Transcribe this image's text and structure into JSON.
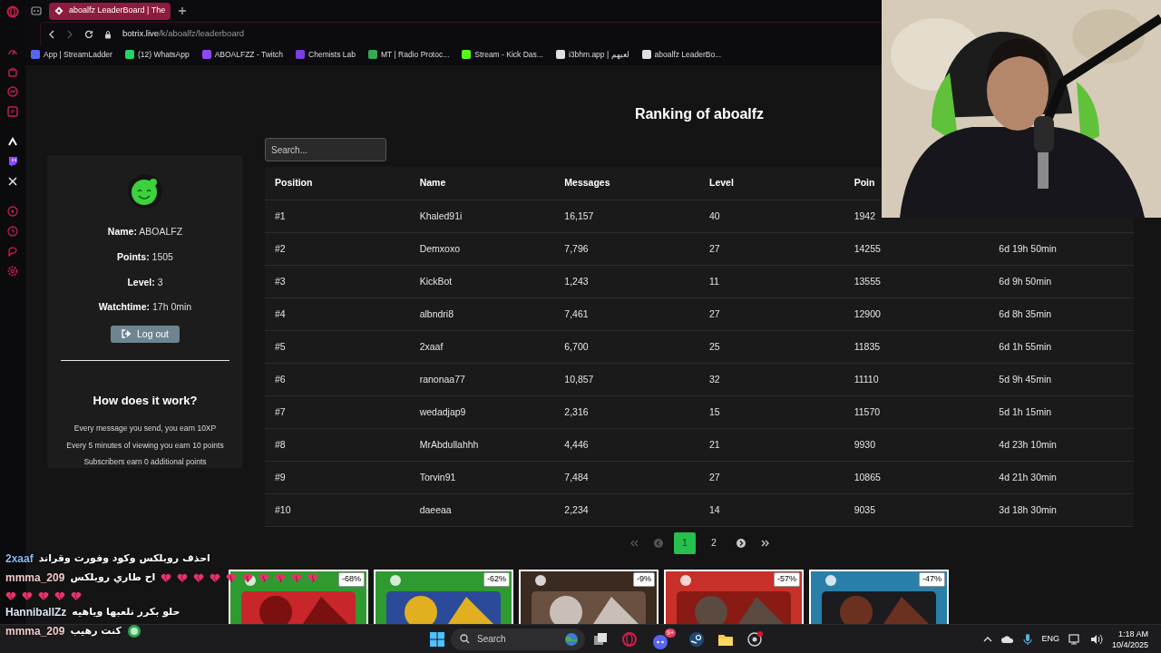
{
  "browser": {
    "tab_title": "aboalfz LeaderBoard | The",
    "url_host": "botrix.live",
    "url_path": "/k/aboalfz/leaderboard",
    "bookmarks": [
      {
        "label": "App | StreamLadder",
        "color": "#5865f2"
      },
      {
        "label": "(12) WhatsApp",
        "color": "#25d366"
      },
      {
        "label": "ABOALFZZ - Twitch",
        "color": "#9146ff"
      },
      {
        "label": "Chemists Lab",
        "color": "#7b3fe4"
      },
      {
        "label": "MT | Radio Protoc...",
        "color": "#34a853"
      },
      {
        "label": "Stream - Kick Das...",
        "color": "#53fc18"
      },
      {
        "label": "i3bhm.app | لعبهم",
        "color": "#e0e0e0"
      },
      {
        "label": "aboalfz LeaderBo...",
        "color": "#e0e0e0"
      }
    ]
  },
  "page": {
    "title": "Ranking of aboalfz",
    "search": {
      "placeholder": "Search..."
    },
    "profile": {
      "fields": [
        "**Name:** ABOALFZ",
        "**Points:** 1505",
        "**Level:** 3",
        "**Watchtime:** 17h 0min"
      ],
      "logout": "Log out",
      "how_title": "How does it work?",
      "how_lines": [
        "Every message you send, you earn 10XP",
        "Every 5 minutes of viewing you earn 10 points",
        "Subscribers earn 0 additional points"
      ]
    },
    "table": {
      "columns": [
        "Position",
        "Name",
        "Messages",
        "Level",
        "Poin"
      ],
      "rows": [
        [
          "#1",
          "Khaled91i",
          "16,157",
          "40",
          "1942"
        ],
        [
          "#2",
          "Demxoxo",
          "7,796",
          "27",
          "14255",
          "6d 19h 50min"
        ],
        [
          "#3",
          "KickBot",
          "1,243",
          "11",
          "13555",
          "6d 9h 50min"
        ],
        [
          "#4",
          "albndri8",
          "7,461",
          "27",
          "12900",
          "6d 8h 35min"
        ],
        [
          "#5",
          "2xaaf",
          "6,700",
          "25",
          "11835",
          "6d 1h 55min"
        ],
        [
          "#6",
          "ranonaa77",
          "10,857",
          "32",
          "11110",
          "5d 9h 45min"
        ],
        [
          "#7",
          "wedadjap9",
          "2,316",
          "15",
          "11570",
          "5d 1h 15min"
        ],
        [
          "#8",
          "MrAbdullahhh",
          "4,446",
          "21",
          "9930",
          "4d 23h 10min"
        ],
        [
          "#9",
          "Torvin91",
          "7,484",
          "27",
          "10865",
          "4d 21h 30min"
        ],
        [
          "#10",
          "daeeaa",
          "2,234",
          "14",
          "9035",
          "3d 18h 30min"
        ]
      ]
    },
    "pagination": {
      "prev_disabled": true,
      "next_disabled": false,
      "pages": [
        {
          "label": "1",
          "selected": true
        },
        {
          "label": "2",
          "selected": false
        }
      ]
    }
  },
  "deals": [
    {
      "discount": "-68%"
    },
    {
      "discount": "-62%"
    },
    {
      "discount": "-9%"
    },
    {
      "discount": "-57%"
    },
    {
      "discount": "-47%"
    }
  ],
  "chat": [
    {
      "user": "2xaaf",
      "color": "#8ab8f0",
      "message": "احذف روبلكس وكود وفورت وقراند"
    },
    {
      "user": "mmma_209",
      "color": "#f2c8c8",
      "message": "اح طاري روبلكس",
      "reactions": [
        {
          "kind": "broken_heart"
        },
        {
          "kind": "broken_heart"
        },
        {
          "kind": "broken_heart"
        },
        {
          "kind": "broken_heart"
        },
        {
          "kind": "broken_heart"
        },
        {
          "kind": "broken_heart"
        },
        {
          "kind": "broken_heart"
        },
        {
          "kind": "broken_heart"
        },
        {
          "kind": "broken_heart"
        },
        {
          "kind": "broken_heart"
        },
        {
          "kind": "broken_heart"
        },
        {
          "kind": "broken_heart"
        },
        {
          "kind": "broken_heart"
        },
        {
          "kind": "broken_heart"
        },
        {
          "kind": "broken_heart"
        }
      ]
    },
    {
      "user": "HannibalIZz",
      "color": "#dce6f5",
      "message": "حلو بكرر نلعبها وياهيه"
    },
    {
      "user": "mmma_209",
      "color": "#f2c8c8",
      "message": "كنت رهيب",
      "reactions": [
        {
          "kind": "emoji"
        }
      ]
    }
  ],
  "taskbar": {
    "search_placeholder": "Search",
    "discord_badge": "9+",
    "language": "ENG",
    "time": "1:18 AM",
    "date": "10/4/2025"
  }
}
